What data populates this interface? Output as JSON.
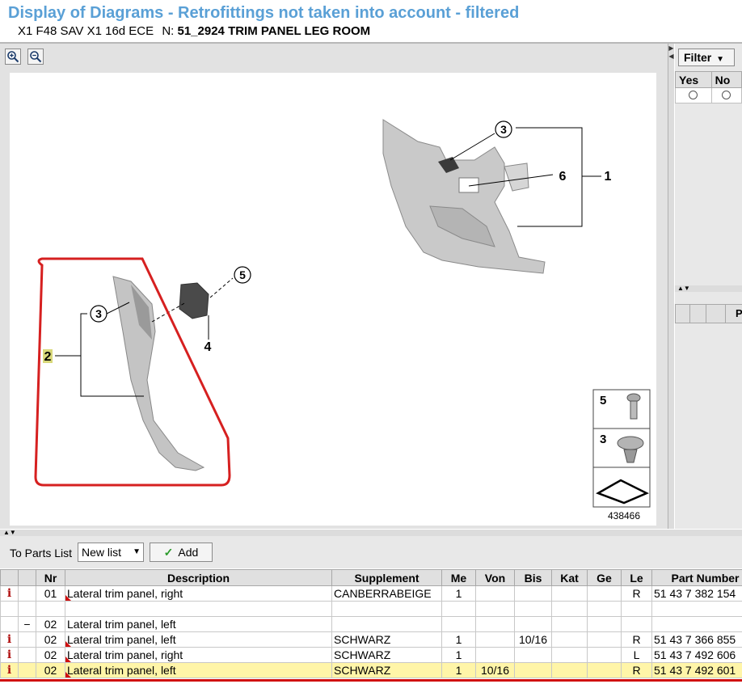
{
  "header": {
    "title": "Display of Diagrams - Retrofittings not taken into account - filtered",
    "vehicle": "X1 F48 SAV X1 16d ECE",
    "n_label": "N:",
    "group": "51_2924 TRIM PANEL LEG ROOM"
  },
  "diagram": {
    "callouts": [
      "3",
      "6",
      "1",
      "5",
      "3",
      "4",
      "2"
    ],
    "legend": [
      "5",
      "3"
    ],
    "image_number": "438466",
    "highlight_color": "#d62020"
  },
  "filter": {
    "button_label": "Filter",
    "columns": [
      "Yes",
      "No"
    ]
  },
  "right_lower": {
    "header_fragment": "P"
  },
  "toolbar": {
    "to_parts_label": "To Parts List",
    "list_value": "New list",
    "add_label": "Add"
  },
  "parts_table": {
    "columns": [
      "",
      "",
      "Nr",
      "Description",
      "Supplement",
      "Me",
      "Von",
      "Bis",
      "Kat",
      "Ge",
      "Le",
      "Part Number"
    ],
    "rows": [
      {
        "info": "i",
        "tree": "",
        "nr": "01",
        "desc": "Lateral trim panel, right",
        "supp": "CANBERRABEIGE",
        "me": "1",
        "von": "",
        "bis": "",
        "kat": "",
        "ge": "",
        "le": "R",
        "pn": "51 43 7 382 154"
      },
      {
        "info": "",
        "tree": "",
        "nr": "",
        "desc": "",
        "supp": "",
        "me": "",
        "von": "",
        "bis": "",
        "kat": "",
        "ge": "",
        "le": "",
        "pn": ""
      },
      {
        "info": "",
        "tree": "−",
        "nr": "02",
        "desc": "Lateral trim panel, left",
        "supp": "",
        "me": "",
        "von": "",
        "bis": "",
        "kat": "",
        "ge": "",
        "le": "",
        "pn": ""
      },
      {
        "info": "i",
        "tree": "",
        "nr": "02",
        "desc": "Lateral trim panel, left",
        "supp": "SCHWARZ",
        "me": "1",
        "von": "",
        "bis": "10/16",
        "kat": "",
        "ge": "",
        "le": "R",
        "pn": "51 43 7 366 855"
      },
      {
        "info": "i",
        "tree": "",
        "nr": "02",
        "desc": "Lateral trim panel, right",
        "supp": "SCHWARZ",
        "me": "1",
        "von": "",
        "bis": "",
        "kat": "",
        "ge": "",
        "le": "L",
        "pn": "51 43 7 492 606"
      },
      {
        "info": "i",
        "tree": "",
        "nr": "02",
        "desc": "Lateral trim panel, left",
        "supp": "SCHWARZ",
        "me": "1",
        "von": "10/16",
        "bis": "",
        "kat": "",
        "ge": "",
        "le": "R",
        "pn": "51 43 7 492 601"
      }
    ]
  }
}
